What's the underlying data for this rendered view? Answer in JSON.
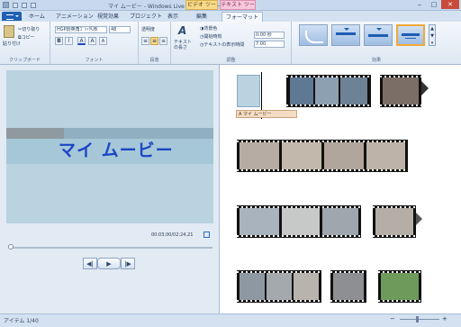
{
  "titlebar": {
    "title": "マイ ムービー - Windows Live ムービー メーカー",
    "context_group_label": "ビデオ ツール",
    "context_group_label2": "テキスト ツール"
  },
  "tabs": {
    "home": "ホーム",
    "animation": "アニメーション",
    "visual_effects": "視覚効果",
    "project": "プロジェクト",
    "view": "表示",
    "edit": "編集",
    "format": "フォーマット"
  },
  "ribbon": {
    "clipboard": {
      "paste": "貼り付け",
      "cut": "切り取り",
      "copy": "コピー",
      "label": "クリップボード"
    },
    "font": {
      "family": "HGP創英角ｺﾞｼｯｸUB",
      "size": "48",
      "label": "フォント"
    },
    "paragraph": {
      "transparency": "透明度",
      "label": "段落"
    },
    "adjust": {
      "text_duration": "テキストの長さ",
      "bg_color": "背景色",
      "start_time": "開始時刻",
      "text_duration2": "テキストの表示時間",
      "start_value": "0.00 秒",
      "duration_value": "7.00",
      "label": "調整"
    },
    "effects": {
      "label": "効果"
    }
  },
  "preview": {
    "title_text": "マイ ムービー",
    "timecode": "00:03.00/02:24.21"
  },
  "storyboard": {
    "title_caption": "A マイ ムービー"
  },
  "status": {
    "items": "アイテム 1/40"
  },
  "colors": {
    "accent": "#1c46c4",
    "file_tab": "#1f5fb3",
    "selected_theme": "#f0a93a"
  }
}
